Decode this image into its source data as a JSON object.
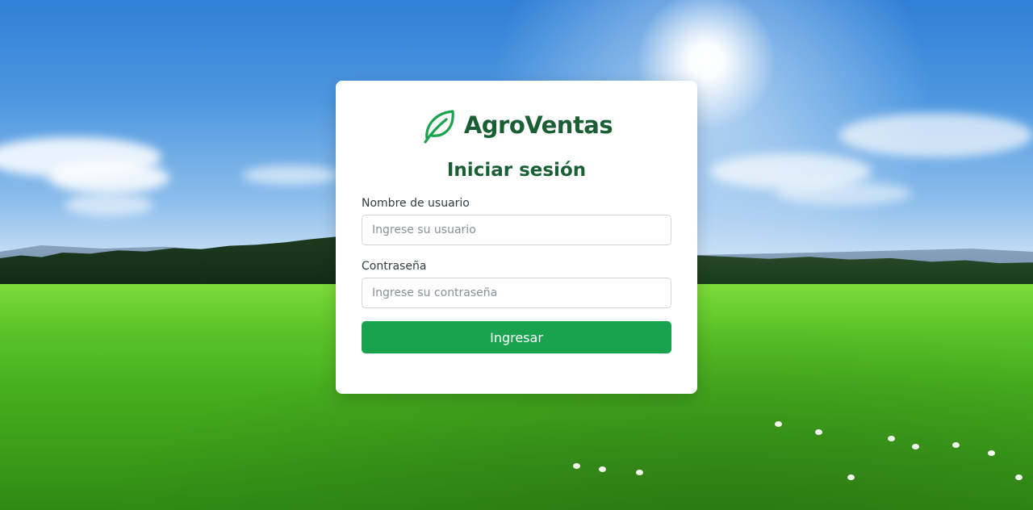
{
  "brand": {
    "name": "AgroVentas",
    "icon": "leaf-icon",
    "color": "#1a5e33"
  },
  "login": {
    "title": "Iniciar sesión",
    "username_label": "Nombre de usuario",
    "username_placeholder": "Ingrese su usuario",
    "username_value": "",
    "password_label": "Contraseña",
    "password_placeholder": "Ingrese su contraseña",
    "password_value": "",
    "submit_label": "Ingresar",
    "accent_color": "#1aa34e"
  }
}
